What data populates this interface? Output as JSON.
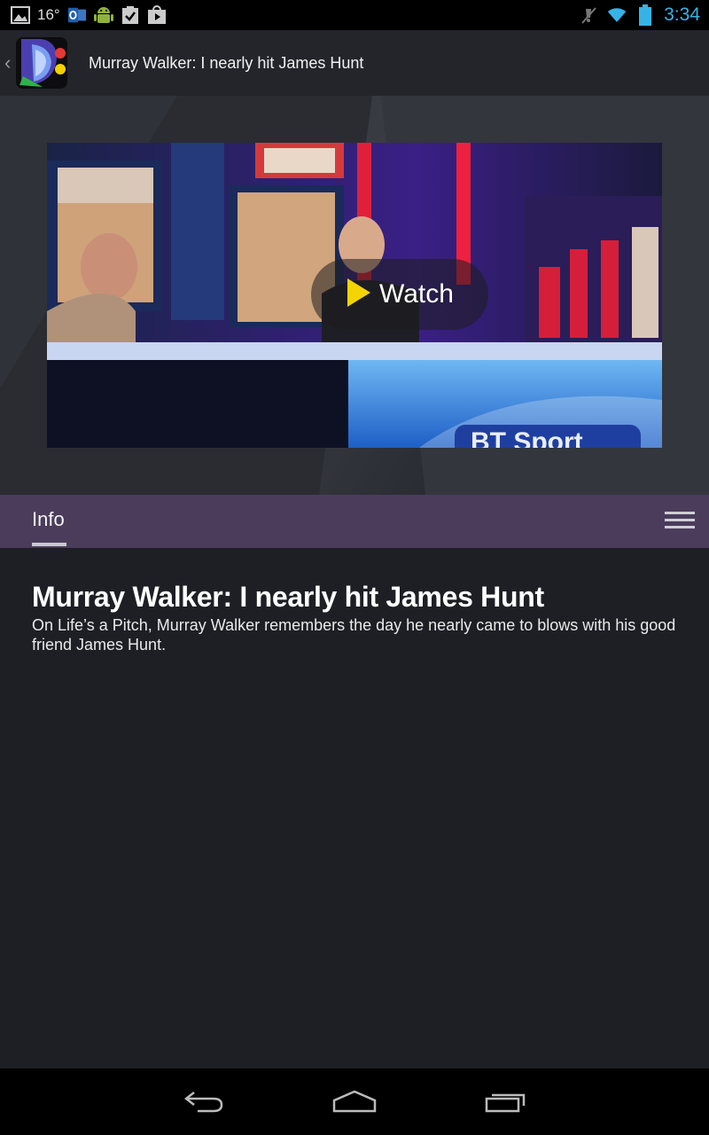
{
  "status_bar": {
    "temperature": "16°",
    "time": "3:34",
    "icons": [
      "image-icon",
      "outlook-icon",
      "android-icon",
      "clipboard-check-icon",
      "play-store-icon",
      "mute-icon",
      "wifi-icon",
      "battery-icon"
    ],
    "time_color": "#36b3e6"
  },
  "action_bar": {
    "title": "Murray Walker: I nearly hit James Hunt",
    "back_glyph": "‹"
  },
  "video": {
    "watch_label": "Watch",
    "play_icon_color": "#f4d400",
    "overlay_text": "BT Sport"
  },
  "tabs": {
    "info_label": "Info",
    "accent": "#4b3c5c"
  },
  "content": {
    "headline": "Murray Walker: I nearly hit James Hunt",
    "description": "On Life’s a Pitch, Murray Walker remembers the day he nearly came to blows with his good friend James Hunt."
  },
  "nav_bar": {
    "icons": [
      "back-icon",
      "home-icon",
      "recent-apps-icon"
    ]
  }
}
